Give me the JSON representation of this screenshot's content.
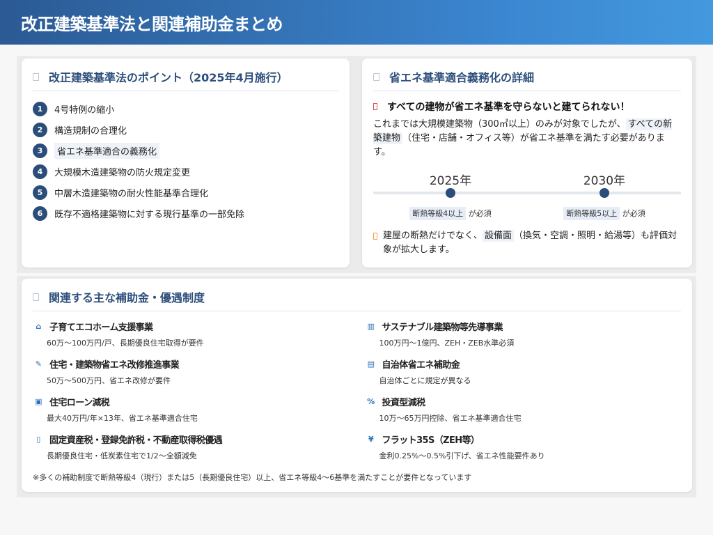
{
  "header": {
    "title": "改正建築基準法と関連補助金まとめ"
  },
  "points_card": {
    "title": "改正建築基準法のポイント（2025年4月施行）",
    "items": [
      {
        "num": "1",
        "text": "4号特例の縮小"
      },
      {
        "num": "2",
        "text": "構造規制の合理化"
      },
      {
        "num": "3",
        "text": "省エネ基準適合の義務化"
      },
      {
        "num": "4",
        "text": "大規模木造建築物の防火規定変更"
      },
      {
        "num": "5",
        "text": "中層木造建築物の耐火性能基準合理化"
      },
      {
        "num": "6",
        "text": "既存不適格建築物に対する現行基準の一部免除"
      }
    ]
  },
  "energy_card": {
    "title": "省エネ基準適合義務化の詳細",
    "alert": "すべての建物が省エネ基準を守らないと建てられない！",
    "desc_before": "これまでは大規模建築物（300㎡以上）のみが対象でしたが、",
    "desc_mark": "すべての新築建物",
    "desc_after": "（住宅・店舗・オフィス等）が省エネ基準を満たす必要があります。",
    "timeline": [
      {
        "year": "2025年",
        "tag": "断熱等級4以上",
        "suffix": "が必須"
      },
      {
        "year": "2030年",
        "tag": "断熱等級5以上",
        "suffix": "が必須"
      }
    ],
    "note_before": "建屋の断熱だけでなく、",
    "note_mark": "設備面",
    "note_after": "（換気・空調・照明・給湯等）も評価対象が拡大します。"
  },
  "subsidy_card": {
    "title": "関連する主な補助金・優遇制度",
    "items": [
      {
        "icon": "house-icon",
        "glyph": "⌂",
        "name": "子育てエコホーム支援事業",
        "desc": "60万～100万円/戸、長期優良住宅取得が要件"
      },
      {
        "icon": "building-icon",
        "glyph": "▥",
        "name": "サステナブル建築物等先導事業",
        "desc": "100万円～1億円、ZEH・ZEB水準必須"
      },
      {
        "icon": "tools-icon",
        "glyph": "✎",
        "name": "住宅・建築物省エネ改修推進事業",
        "desc": "50万～500万円、省エネ改修が要件"
      },
      {
        "icon": "city-icon",
        "glyph": "▤",
        "name": "自治体省エネ補助金",
        "desc": "自治体ごとに規定が異なる"
      },
      {
        "icon": "loan-icon",
        "glyph": "▣",
        "name": "住宅ローン減税",
        "desc": "最大40万円/年×13年、省エネ基準適合住宅"
      },
      {
        "icon": "percent-icon",
        "glyph": "%",
        "name": "投資型減税",
        "desc": "10万～65万円控除、省エネ基準適合住宅"
      },
      {
        "icon": "document-icon",
        "glyph": "▯",
        "name": "固定資産税・登録免許税・不動産取得税優遇",
        "desc": "長期優良住宅・低炭素住宅で1/2～全額減免"
      },
      {
        "icon": "money-icon",
        "glyph": "¥",
        "name": "フラット35S（ZEH等）",
        "desc": "金利0.25%～0.5%引下げ、省エネ性能要件あり"
      }
    ],
    "footnote": "※多くの補助制度で断熱等級4（現行）または5（長期優良住宅）以上、省エネ等級4～6基準を満たすことが要件となっています"
  }
}
